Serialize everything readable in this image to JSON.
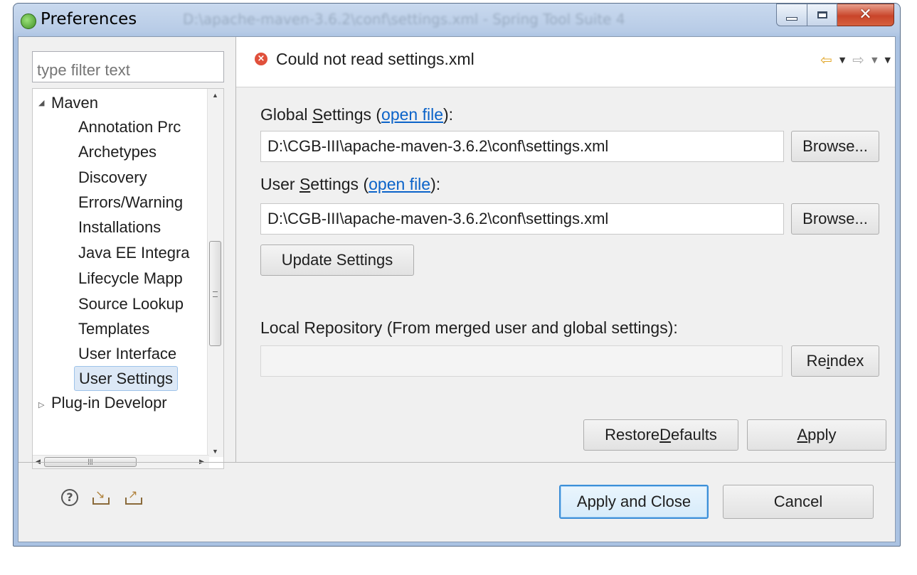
{
  "window": {
    "title": "Preferences",
    "background_title": "D:\\apache-maven-3.6.2\\conf\\settings.xml - Spring Tool Suite 4"
  },
  "sidebar": {
    "filter_placeholder": "type filter text",
    "tree": [
      {
        "label": "Maven",
        "expanded": true
      },
      {
        "label": "Annotation Prc"
      },
      {
        "label": "Archetypes"
      },
      {
        "label": "Discovery"
      },
      {
        "label": "Errors/Warning"
      },
      {
        "label": "Installations"
      },
      {
        "label": "Java EE Integra"
      },
      {
        "label": "Lifecycle Mapp"
      },
      {
        "label": "Source Lookup"
      },
      {
        "label": "Templates"
      },
      {
        "label": "User Interface"
      },
      {
        "label": "User Settings",
        "selected": true
      },
      {
        "label": "Plug-in Developr",
        "expanded": false
      }
    ]
  },
  "page": {
    "header": "Could not read settings.xml",
    "global_label_pre": "Global ",
    "global_label_mn": "S",
    "global_label_post": "ettings (",
    "open_file": "open file",
    "label_close": "):",
    "global_path": "D:\\CGB-III\\apache-maven-3.6.2\\conf\\settings.xml",
    "browse": "Browse...",
    "user_label_pre": "User ",
    "user_label_mn": "S",
    "user_label_post": "ettings (",
    "user_path": "D:\\CGB-III\\apache-maven-3.6.2\\conf\\settings.xml",
    "update_settings": "Update Settings",
    "local_repo_label": "Local Repository (From merged user and global settings):",
    "local_repo_value": "",
    "reindex_pre": "Re",
    "reindex_mn": "i",
    "reindex_post": "ndex",
    "restore_pre": "Restore ",
    "restore_mn": "D",
    "restore_post": "efaults",
    "apply_mn": "A",
    "apply_post": "pply"
  },
  "footer": {
    "apply_close": "Apply and Close",
    "cancel": "Cancel"
  },
  "colors": {
    "link": "#0b63c9",
    "error": "#e0503b",
    "selection": "#dce8f6",
    "default_button_border": "#3c8fd8"
  }
}
